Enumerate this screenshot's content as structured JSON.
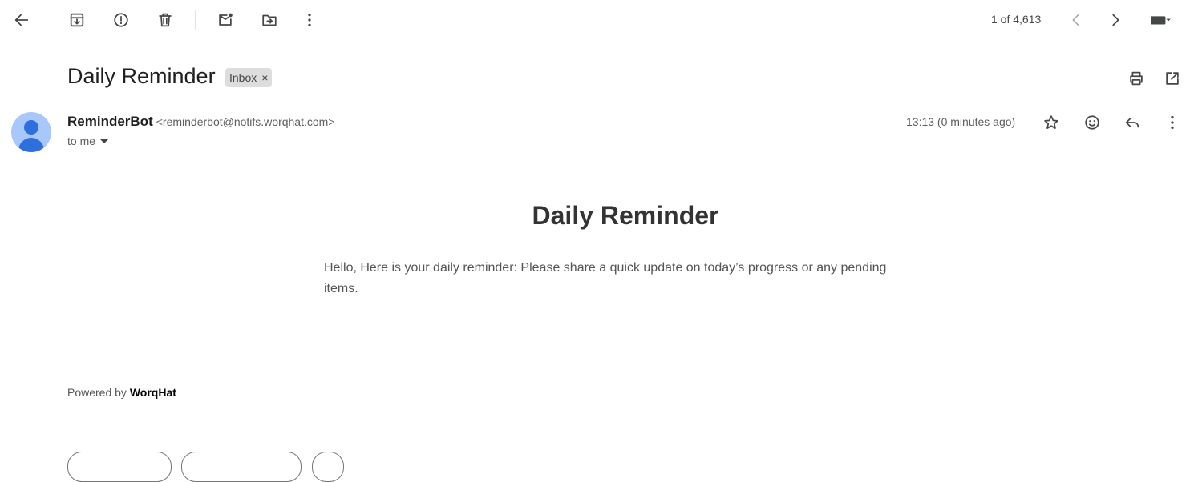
{
  "toolbar": {
    "icons": {
      "back": "arrow-left-icon",
      "archive": "archive-icon",
      "report_spam": "report-spam-icon",
      "delete": "trash-icon",
      "mark_unread": "mark-unread-icon",
      "move_to": "move-to-folder-icon",
      "more": "more-vertical-icon"
    },
    "pager": {
      "text": "1 of 4,613",
      "prev_icon": "chevron-left-icon",
      "next_icon": "chevron-right-icon"
    },
    "input_tools_icon": "keyboard-icon"
  },
  "message": {
    "subject": "Daily Reminder",
    "label": "Inbox",
    "label_remove": "×",
    "print_icon": "print-icon",
    "open_new_window_icon": "open-in-new-icon",
    "sender_name": "ReminderBot",
    "sender_email": "<reminderbot@notifs.worqhat.com>",
    "recipient": "to me",
    "time": "13:13 (0 minutes ago)",
    "actions": {
      "star": "star-icon",
      "emoji": "emoji-icon",
      "reply": "reply-icon",
      "more": "more-vertical-icon"
    },
    "body_title": "Daily Reminder",
    "body_text": "Hello, Here is your daily reminder: Please share a quick update on today’s progress or any pending items.",
    "footer_prefix": "Powered by",
    "footer_brand": "WorqHat"
  },
  "colors": {
    "icon": "#444746",
    "avatar_bg": "#a8c7fa",
    "avatar_fg": "#1a5fd7",
    "chip_bg": "#dddddd",
    "body_title": "#333333",
    "body_text": "#555555"
  }
}
